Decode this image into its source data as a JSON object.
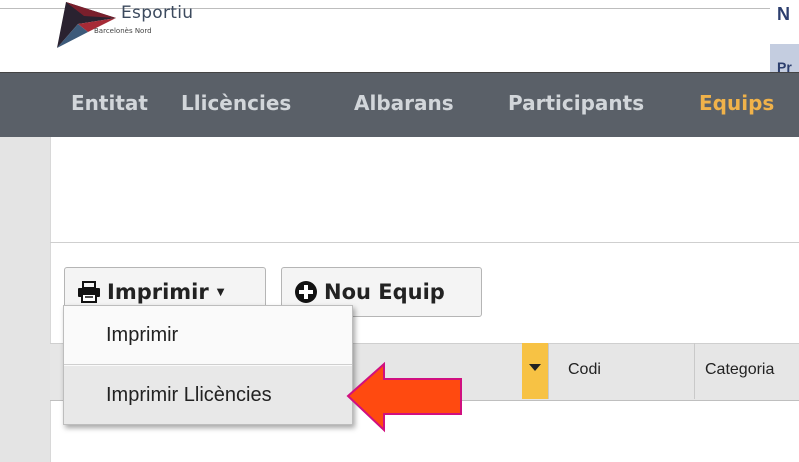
{
  "header": {
    "brand_name": "Esportiu",
    "brand_subtitle": "Barcelonès Nord",
    "right_cutoff_letter": "N",
    "right_cutoff_block_text": "Pr"
  },
  "nav": {
    "items": [
      {
        "label": "Entitat",
        "active": false
      },
      {
        "label": "Llicències",
        "active": false
      },
      {
        "label": "Albarans",
        "active": false
      },
      {
        "label": "Participants",
        "active": false
      },
      {
        "label": "Equips",
        "active": true
      }
    ],
    "active_color": "#f0b24a",
    "bar_color": "#5a6068"
  },
  "toolbar": {
    "print_label": "Imprimir",
    "print_icon": "printer-icon",
    "new_label": "Nou Equip",
    "new_icon": "plus-circle-icon"
  },
  "dropdown": {
    "items": [
      {
        "label": "Imprimir"
      },
      {
        "label": "Imprimir Llicències",
        "hovered": true
      }
    ]
  },
  "table": {
    "columns": [
      "Codi",
      "Categoria"
    ],
    "sort_accent": "#f7c244"
  },
  "annotation": {
    "arrow_color": "#ff4a10"
  }
}
